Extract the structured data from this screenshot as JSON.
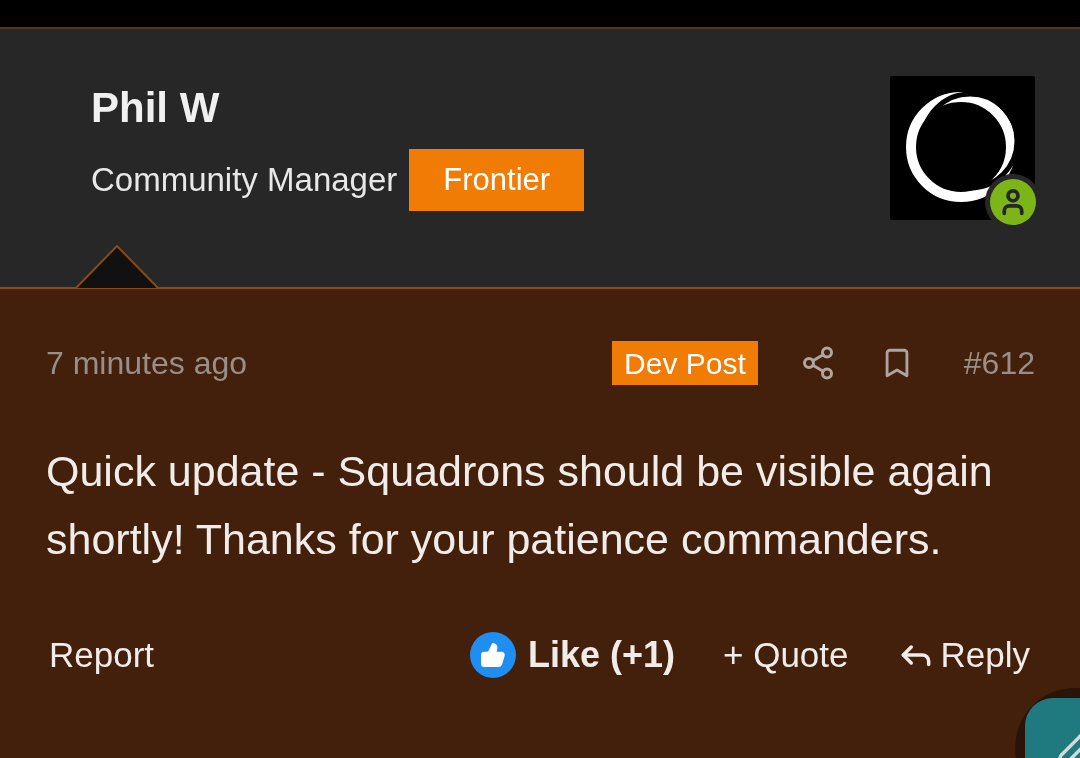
{
  "author": {
    "name": "Phil W",
    "role": "Community Manager",
    "badge": "Frontier",
    "online": true
  },
  "post": {
    "time": "7 minutes ago",
    "badge": "Dev Post",
    "number": "#612",
    "body": "Quick update - Squadrons should be visible again shortly! Thanks for your patience commanders."
  },
  "actions": {
    "report": "Report",
    "like": "Like (+1)",
    "quote": "Quote",
    "quote_prefix": "+",
    "reply": "Reply"
  }
}
